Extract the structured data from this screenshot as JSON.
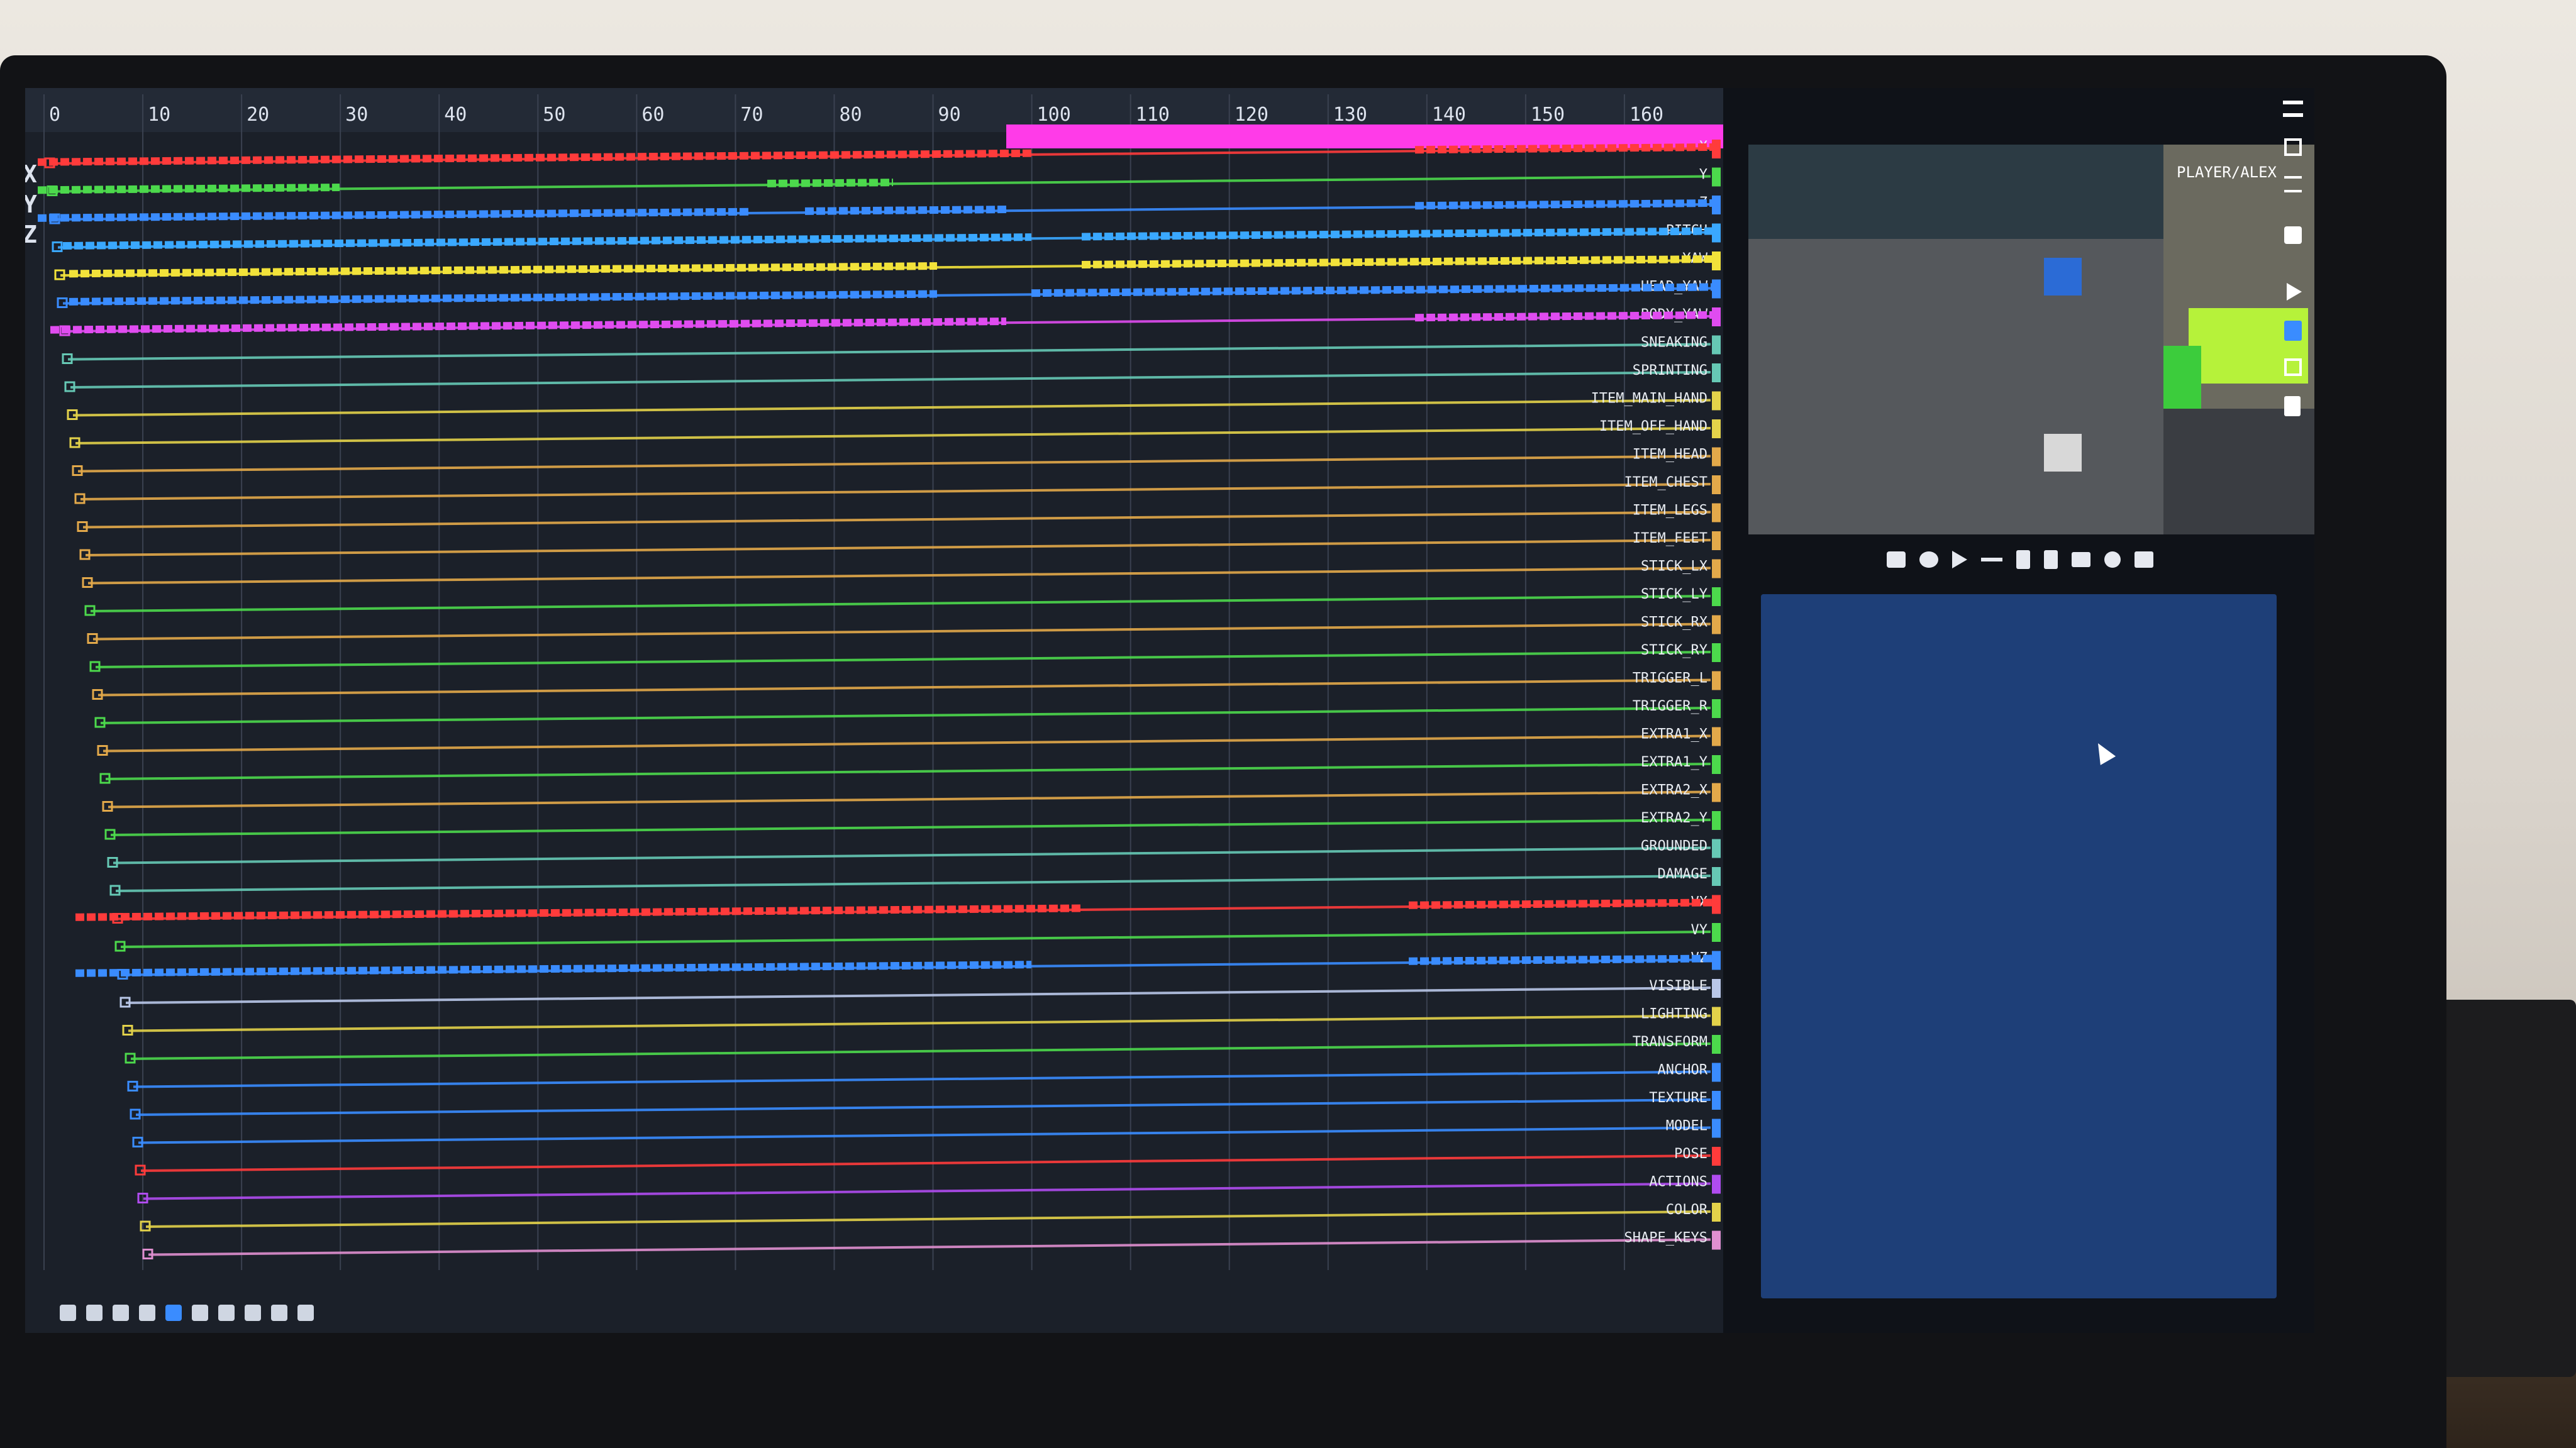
{
  "timeline": {
    "ticks": [
      "0",
      "10",
      "20",
      "30",
      "40",
      "50",
      "60",
      "70",
      "80",
      "90",
      "100",
      "110",
      "120",
      "130",
      "140",
      "150",
      "160"
    ],
    "axis_letters": [
      "X",
      "Y",
      "Z"
    ],
    "tracks": [
      {
        "label": "X",
        "color": "#ff3b3b"
      },
      {
        "label": "Y",
        "color": "#4cd94c"
      },
      {
        "label": "Z",
        "color": "#3a8cff"
      },
      {
        "label": "PITCH",
        "color": "#3aa8ff"
      },
      {
        "label": "YAW",
        "color": "#f2e23a"
      },
      {
        "label": "HEAD_YAW",
        "color": "#3a8cff"
      },
      {
        "label": "BODY_YAW",
        "color": "#e04cf0"
      },
      {
        "label": "SNEAKING",
        "color": "#66c9b5"
      },
      {
        "label": "SPRINTING",
        "color": "#66c9b5"
      },
      {
        "label": "ITEM_MAIN_HAND",
        "color": "#e3d24a"
      },
      {
        "label": "ITEM_OFF_HAND",
        "color": "#e3d24a"
      },
      {
        "label": "ITEM_HEAD",
        "color": "#e3a94a"
      },
      {
        "label": "ITEM_CHEST",
        "color": "#e3a94a"
      },
      {
        "label": "ITEM_LEGS",
        "color": "#e3a94a"
      },
      {
        "label": "ITEM_FEET",
        "color": "#e3a94a"
      },
      {
        "label": "STICK_LX",
        "color": "#e3a94a"
      },
      {
        "label": "STICK_LY",
        "color": "#4cd94c"
      },
      {
        "label": "STICK_RX",
        "color": "#e3a94a"
      },
      {
        "label": "STICK_RY",
        "color": "#4cd94c"
      },
      {
        "label": "TRIGGER_L",
        "color": "#e3a94a"
      },
      {
        "label": "TRIGGER_R",
        "color": "#4cd94c"
      },
      {
        "label": "EXTRA1_X",
        "color": "#e3a94a"
      },
      {
        "label": "EXTRA1_Y",
        "color": "#4cd94c"
      },
      {
        "label": "EXTRA2_X",
        "color": "#e3a94a"
      },
      {
        "label": "EXTRA2_Y",
        "color": "#4cd94c"
      },
      {
        "label": "GROUNDED",
        "color": "#66c9b5"
      },
      {
        "label": "DAMAGE",
        "color": "#66c9b5"
      },
      {
        "label": "VX",
        "color": "#ff3b3b"
      },
      {
        "label": "VY",
        "color": "#4cd94c"
      },
      {
        "label": "VZ",
        "color": "#3a8cff"
      },
      {
        "label": "VISIBLE",
        "color": "#b9c7e8"
      },
      {
        "label": "LIGHTING",
        "color": "#e3d24a"
      },
      {
        "label": "TRANSFORM",
        "color": "#4cd94c"
      },
      {
        "label": "ANCHOR",
        "color": "#3a8cff"
      },
      {
        "label": "TEXTURE",
        "color": "#3a8cff"
      },
      {
        "label": "MODEL",
        "color": "#3a8cff"
      },
      {
        "label": "POSE",
        "color": "#ff3b3b"
      },
      {
        "label": "ACTIONS",
        "color": "#b04cf0"
      },
      {
        "label": "COLOR",
        "color": "#e3d24a"
      },
      {
        "label": "SHAPE_KEYS",
        "color": "#e08fd0"
      }
    ]
  },
  "preview": {
    "entity_name": "PLAYER/ALEX"
  },
  "icons": {
    "menu": "menu-icon",
    "save": "save-icon",
    "list": "list-icon",
    "swap": "swap-icon",
    "play": "play-icon",
    "cursor": "cursor-icon"
  },
  "colors": {
    "screen_bg": "#1b2029",
    "selection": "#ff3be8",
    "props_panel": "#1e3f78"
  }
}
